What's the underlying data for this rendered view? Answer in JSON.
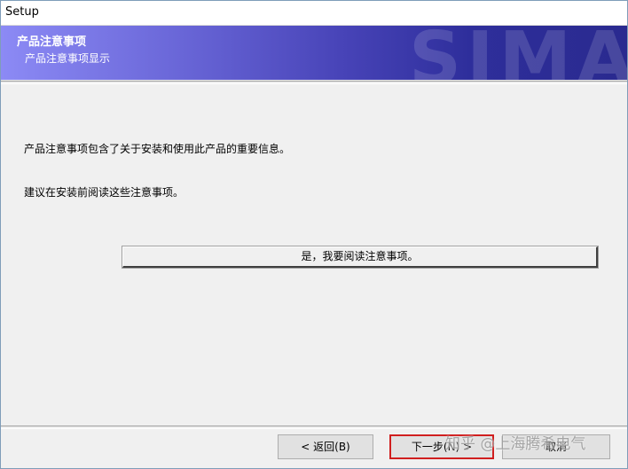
{
  "window": {
    "title": "Setup"
  },
  "banner": {
    "heading": "产品注意事项",
    "subheading": "产品注意事项显示",
    "watermark": "SIMA"
  },
  "main": {
    "paragraph1": "产品注意事项包含了关于安装和使用此产品的重要信息。",
    "paragraph2": "建议在安装前阅读这些注意事项。",
    "read_button_label": "是，我要阅读注意事项。"
  },
  "footer": {
    "back_label": "< 返回(B)",
    "next_label": "下一步(N) >",
    "cancel_label": "取消"
  },
  "overlay": {
    "watermark_text": "知乎 @上海腾希电气"
  },
  "colors": {
    "banner_start": "#8c8af5",
    "banner_end": "#2a2a8f",
    "highlight_border": "#d01f1f"
  }
}
